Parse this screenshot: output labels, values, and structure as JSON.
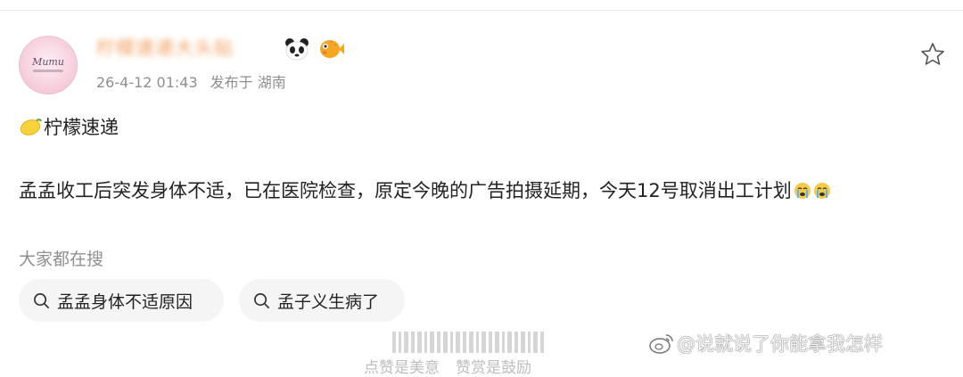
{
  "post": {
    "username": "柠檬速递大头贴",
    "timestamp": "26-4-12 01:43",
    "location": "发布于 湖南",
    "line1": "柠檬速递",
    "body": "孟孟收工后突发身体不适，已在医院检查，原定今晚的广告拍摄延期，今天12号取消出工计划",
    "icons": {
      "avatar": "avatar",
      "favorite": "star-outline-icon",
      "lemon": "lemon-emoji-icon",
      "panda": "panda-emoji-icon",
      "fish": "pufferfish-emoji-icon",
      "sad": "crying-face-emoji-icon"
    }
  },
  "search": {
    "title": "大家都在搜",
    "chips": [
      {
        "label": "孟孟身体不适原因"
      },
      {
        "label": "孟子义生病了"
      }
    ]
  },
  "footer": {
    "like_text": "点赞是美意",
    "reward_text": "赞赏是鼓励"
  },
  "watermark": {
    "text": "@说就说了你能拿我怎样"
  },
  "colors": {
    "username": "#ef7f2a",
    "meta": "#8f8f8f",
    "chip_bg": "#f5f5f5",
    "text": "#222222"
  }
}
